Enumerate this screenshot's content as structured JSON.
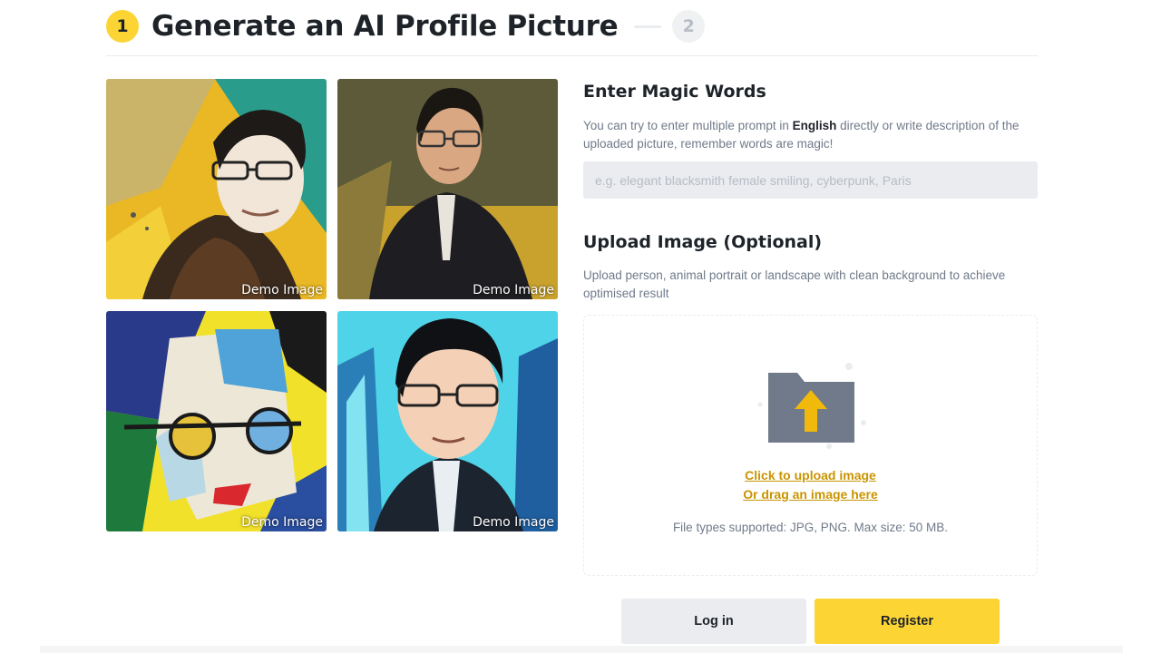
{
  "stepper": {
    "step1_number": "1",
    "step1_title": "Generate an AI Profile Picture",
    "step2_number": "2",
    "active_color": "#fcd535"
  },
  "demo_images": [
    {
      "label": "Demo Image",
      "style": "halftone-yellow-teal"
    },
    {
      "label": "Demo Image",
      "style": "oil-painting-dark"
    },
    {
      "label": "Demo Image",
      "style": "cubist-abstract"
    },
    {
      "label": "Demo Image",
      "style": "anime-cyan"
    }
  ],
  "magic_words": {
    "title": "Enter Magic Words",
    "desc_before": "You can try to enter multiple prompt in ",
    "desc_bold": "English",
    "desc_after": " directly or write description of the uploaded picture, remember words are magic!",
    "input_value": "",
    "placeholder": "e.g. elegant blacksmith female smiling, cyberpunk, Paris"
  },
  "upload": {
    "title": "Upload Image (Optional)",
    "desc": "Upload person, animal portrait or landscape with clean background to achieve optimised result",
    "icon": "folder-upload-icon",
    "link_click": "Click to upload image",
    "link_drag": "Or drag an image here",
    "file_types": "File types supported: JPG, PNG. Max size: 50 MB.",
    "link_color": "#c99400"
  },
  "actions": {
    "login_label": "Log in",
    "register_label": "Register",
    "register_color": "#fcd535"
  }
}
